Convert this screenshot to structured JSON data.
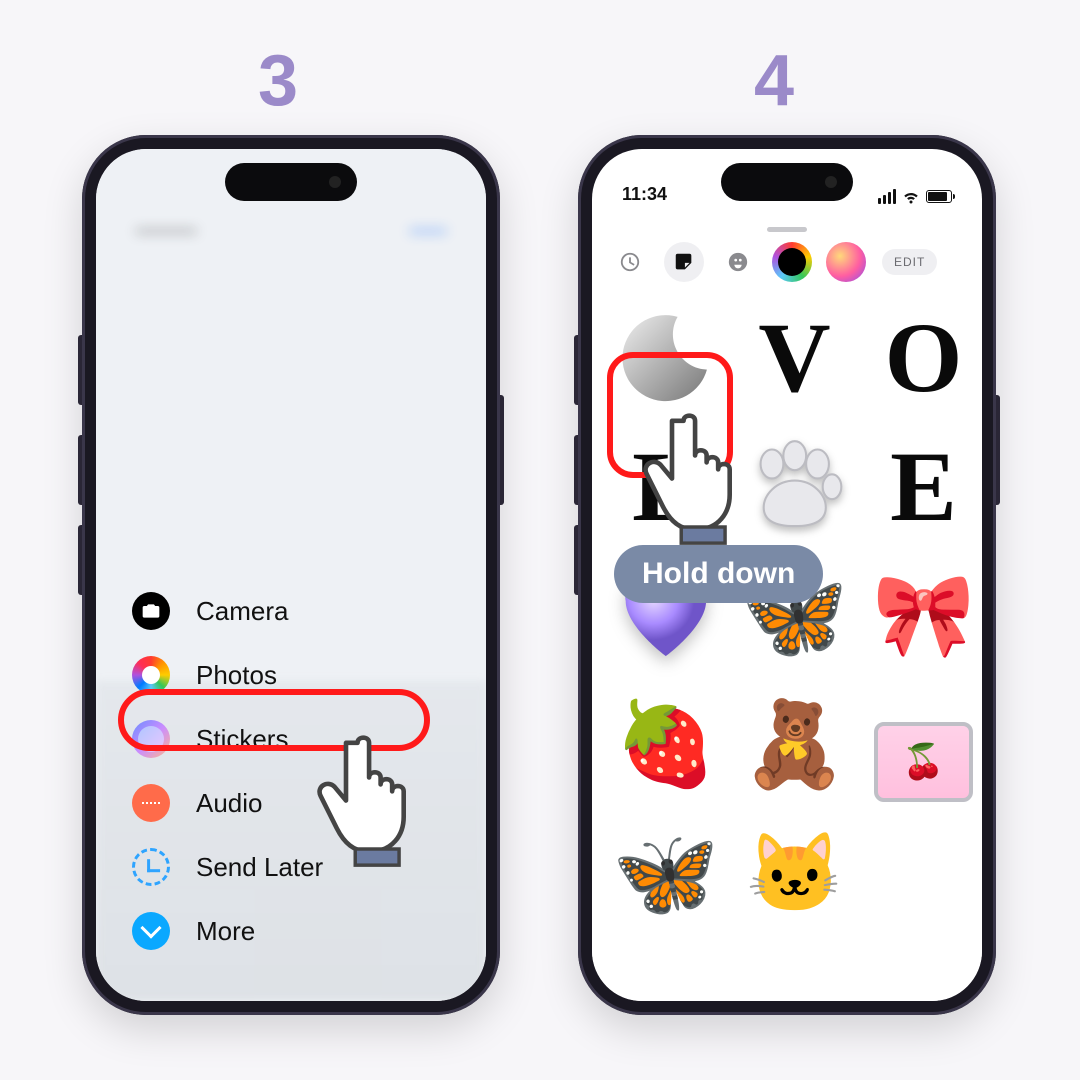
{
  "steps": {
    "left": "3",
    "right": "4"
  },
  "menu": {
    "items": [
      {
        "label": "Camera",
        "icon": "camera-icon"
      },
      {
        "label": "Photos",
        "icon": "photos-icon"
      },
      {
        "label": "Stickers",
        "icon": "stickers-icon",
        "highlighted": true
      },
      {
        "label": "Audio",
        "icon": "audio-icon"
      },
      {
        "label": "Send Later",
        "icon": "send-later-icon"
      },
      {
        "label": "More",
        "icon": "more-icon"
      }
    ]
  },
  "sticker_panel": {
    "status_time": "11:34",
    "edit_label": "EDIT",
    "tabs": [
      "recents",
      "stickers",
      "emoji",
      "memoji",
      "pack"
    ],
    "stickers": [
      "moon",
      "letter-V",
      "letter-O",
      "letter-L",
      "paw",
      "letter-E",
      "heart",
      "butterfly",
      "bow",
      "strawberry",
      "teddy-bear",
      "cherry-tv",
      "pink-butterfly",
      "cat-heart"
    ],
    "highlighted_sticker": "heart",
    "tooltip": "Hold down"
  },
  "colors": {
    "step_number": "#9b8ac9",
    "highlight": "#ff1a1a",
    "tooltip_bg": "#7a8aa6"
  }
}
